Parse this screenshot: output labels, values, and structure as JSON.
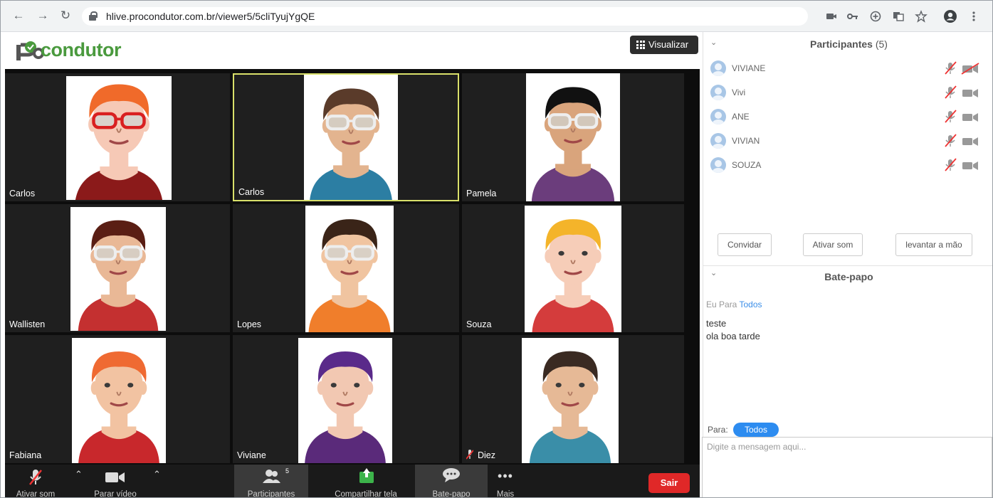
{
  "browser": {
    "url": "hlive.procondutor.com.br/viewer5/5cliTyujYgQE",
    "nav": {
      "back": "←",
      "forward": "→",
      "reload": "↻"
    },
    "icons": [
      "camera-icon",
      "key-icon",
      "add-icon",
      "translate-icon",
      "star-icon",
      "account-icon",
      "menu-icon"
    ]
  },
  "app": {
    "logo_text": "condutor",
    "view_button": "Visualizar"
  },
  "tiles": [
    {
      "name": "Carlos",
      "hair": "#f06a2a",
      "shirt": "#8b1a1a",
      "skin": "#f6c9b6",
      "glasses": "#d92020",
      "active": false
    },
    {
      "name": "Carlos",
      "hair": "#5a3b2a",
      "shirt": "#2c7ea3",
      "skin": "#e3b48f",
      "glasses": "#ffffff",
      "active": true
    },
    {
      "name": "Pamela",
      "hair": "#111111",
      "shirt": "#6b3d7c",
      "skin": "#d9a47c",
      "glasses": "#ffffff",
      "active": false
    },
    {
      "name": "Wallisten",
      "hair": "#5a1e14",
      "shirt": "#c43030",
      "skin": "#e9b896",
      "glasses": "#ffffff",
      "active": false
    },
    {
      "name": "Lopes",
      "hair": "#3a2418",
      "shirt": "#f07e2b",
      "skin": "#f0c4a0",
      "glasses": "#ffffff",
      "active": false
    },
    {
      "name": "Souza",
      "hair": "#f4b42a",
      "shirt": "#d43c3c",
      "skin": "#f6cdb8",
      "glasses": "",
      "active": false
    },
    {
      "name": "Fabiana",
      "hair": "#ef6a32",
      "shirt": "#c8282c",
      "skin": "#f2c3a2",
      "glasses": "",
      "active": false
    },
    {
      "name": "Viviane",
      "hair": "#5a2a8a",
      "shirt": "#5a2a7a",
      "skin": "#f2c8b2",
      "glasses": "",
      "active": false
    },
    {
      "name": "Diez",
      "hair": "#3a2a22",
      "shirt": "#3a8ea8",
      "skin": "#e6b996",
      "glasses": "",
      "active": false,
      "muted": true
    }
  ],
  "toolbar": {
    "audio": "Ativar som",
    "video": "Parar vídeo",
    "participants": "Participantes",
    "participants_count": "5",
    "share": "Compartilhar tela",
    "chat": "Bate-papo",
    "more": "Mais",
    "leave": "Sair"
  },
  "participants_panel": {
    "title": "Participantes",
    "count": "(5)",
    "people": [
      {
        "name": "VIVIANE",
        "video_off": true
      },
      {
        "name": "Vivi",
        "video_off": false
      },
      {
        "name": "ANE",
        "video_off": false
      },
      {
        "name": "VIVIAN",
        "video_off": false
      },
      {
        "name": "SOUZA",
        "video_off": false
      }
    ],
    "invite": "Convidar",
    "unmute": "Ativar som",
    "raise_hand": "levantar a mão"
  },
  "chat": {
    "title": "Bate-papo",
    "from_label": "Eu Para",
    "to": "Todos",
    "messages": [
      "teste",
      "ola boa tarde"
    ],
    "para_label": "Para:",
    "recipient": "Todos",
    "placeholder": "Digite a mensagem aqui..."
  },
  "colors": {
    "accent_green": "#4a9a3e",
    "leave_red": "#e02828",
    "chat_blue": "#2d8cf0",
    "active_border": "#d9e06a"
  }
}
